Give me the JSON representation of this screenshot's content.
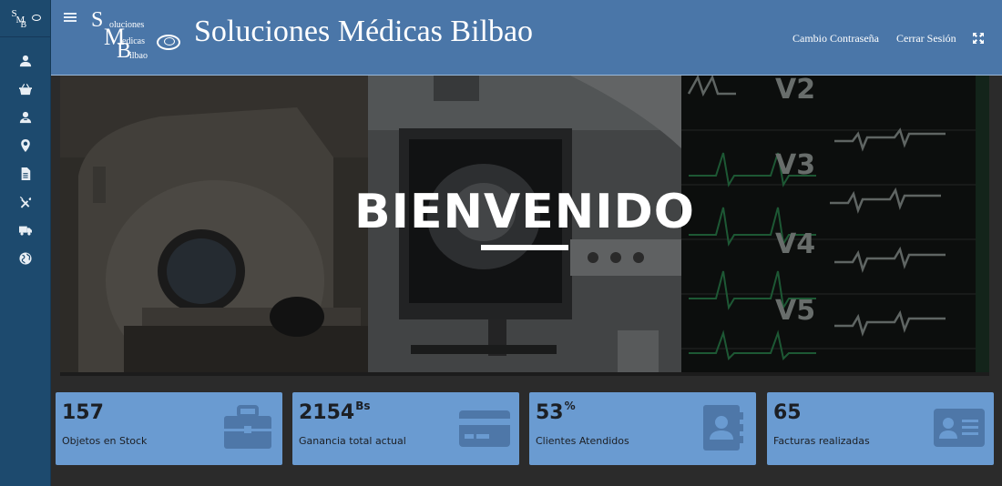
{
  "app": {
    "title": "Soluciones Médicas Bilbao",
    "logo_letters": [
      "S",
      "M",
      "B"
    ],
    "logo_words": [
      "oluciones",
      "edicas",
      "ilbao"
    ]
  },
  "topbar": {
    "change_password": "Cambio Contraseña",
    "logout": "Cerrar Sesión",
    "icons": {
      "menu": "hamburger-icon",
      "fullscreen": "expand-icon"
    }
  },
  "sidebar": {
    "items": [
      {
        "icon": "user-icon"
      },
      {
        "icon": "basket-icon"
      },
      {
        "icon": "users-icon"
      },
      {
        "icon": "map-marker-icon"
      },
      {
        "icon": "document-icon"
      },
      {
        "icon": "tools-icon"
      },
      {
        "icon": "truck-icon"
      },
      {
        "icon": "globe-icon"
      }
    ]
  },
  "hero": {
    "title": "BIENVENIDO"
  },
  "cards": [
    {
      "value": "157",
      "unit": "",
      "label": "Objetos en Stock",
      "icon": "briefcase-icon"
    },
    {
      "value": "2154",
      "unit": "Bs",
      "label": "Ganancia total actual",
      "icon": "credit-card-icon"
    },
    {
      "value": "53",
      "unit": "%",
      "label": "Clientes Atendidos",
      "icon": "contact-book-icon"
    },
    {
      "value": "65",
      "unit": "",
      "label": "Facturas realizadas",
      "icon": "id-card-icon"
    }
  ],
  "colors": {
    "sidebar": "#1d4a6e",
    "topbar": "#4a76a8",
    "card": "#6a9bd1",
    "background": "#2b2b2b"
  }
}
